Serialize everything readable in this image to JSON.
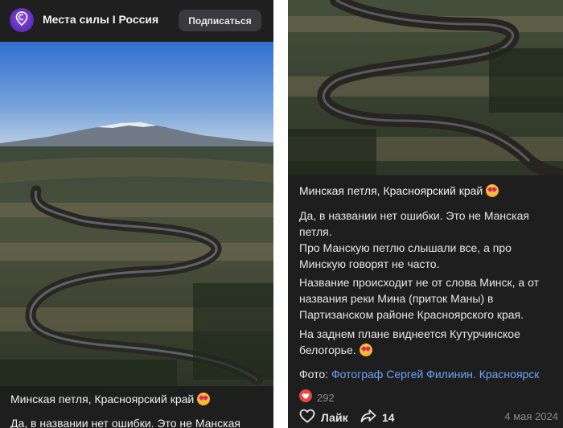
{
  "channel": {
    "name": "Места силы I Россия",
    "subscribe_label": "Подписаться"
  },
  "post": {
    "title": "Минская петля, Красноярский край",
    "partial_line": "Да, в названии нет ошибки. Это не Манская",
    "paragraphs": [
      [
        "Да, в названии нет ошибки. Это не Манская",
        "петля.",
        "Про Манскую петлю слышали все, а про",
        "Минскую говорят не часто."
      ],
      [
        "Название происходит не от слова Минск, а от",
        "названия реки Мина (приток Маны) в",
        "Партизанском районе Красноярского края."
      ],
      [
        "На заднем плане виднеется Кутурчинское",
        "белогорье."
      ]
    ],
    "photo_prefix": "Фото: ",
    "photo_credit": "Фотограф Сергей Филинин. Красноярск",
    "reaction_count": "292",
    "like_label": "Лайк",
    "share_count": "14",
    "date": "4 мая 2024"
  },
  "icons": {
    "avatar": "location-pin-icon",
    "emoji": "heart-eyes-emoji-icon",
    "reaction": "heart-icon",
    "like": "heart-outline-icon",
    "share": "share-arrow-icon"
  },
  "colors": {
    "background": "#1e1e1f",
    "accent": "#6d3cd0",
    "link": "#6ea3f5",
    "reaction": "#e64646"
  }
}
